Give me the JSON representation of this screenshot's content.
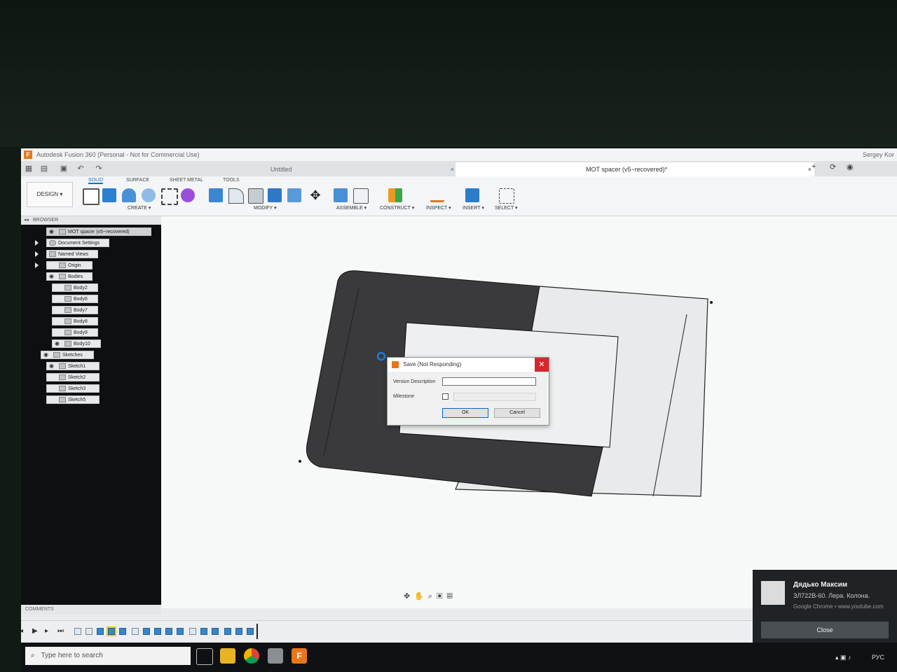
{
  "window": {
    "title": "Autodesk Fusion 360 (Personal - Not for Commercial Use)",
    "user": "Sergey Kor"
  },
  "tabs": [
    {
      "label": "Untitled"
    },
    {
      "label": "MOT spacer (v5~recovered)*"
    }
  ],
  "toolbar": {
    "design_label": "DESIGN ▾",
    "tabs": [
      "SOLID",
      "SURFACE",
      "SHEET METAL",
      "TOOLS"
    ],
    "groups": [
      "CREATE ▾",
      "MODIFY ▾",
      "ASSEMBLE ▾",
      "CONSTRUCT ▾",
      "INSPECT ▾",
      "INSERT ▾",
      "SELECT ▾"
    ]
  },
  "browser": {
    "header": "BROWSER",
    "root": "MOT spacer (v5~recovered)",
    "items": [
      "Document Settings",
      "Named Views",
      "Origin",
      "Bodies",
      "Body2",
      "Body6",
      "Body7",
      "Body8",
      "Body9",
      "Body10",
      "Sketches",
      "Sketch1",
      "Sketch2",
      "Sketch3",
      "Sketch5"
    ],
    "comments_label": "COMMENTS"
  },
  "dialog": {
    "title": "Save (Not Responding)",
    "version_label": "Version Description",
    "version_value": "",
    "milestone_label": "Milestone",
    "ok_label": "OK",
    "cancel_label": "Cancel"
  },
  "notification": {
    "name": "Дядько Максим",
    "message": "ЗЛ722В-60. Лера. Колона.",
    "source": "Google Chrome • www.youtube.com",
    "close_label": "Close"
  },
  "taskbar": {
    "search_placeholder": "Type here to search",
    "lang": "РУС"
  },
  "colors": {
    "accent": "#1a6fc0",
    "close_red": "#d7262b",
    "fusion_orange": "#e8761a",
    "model_body": "#3a3a3c"
  }
}
